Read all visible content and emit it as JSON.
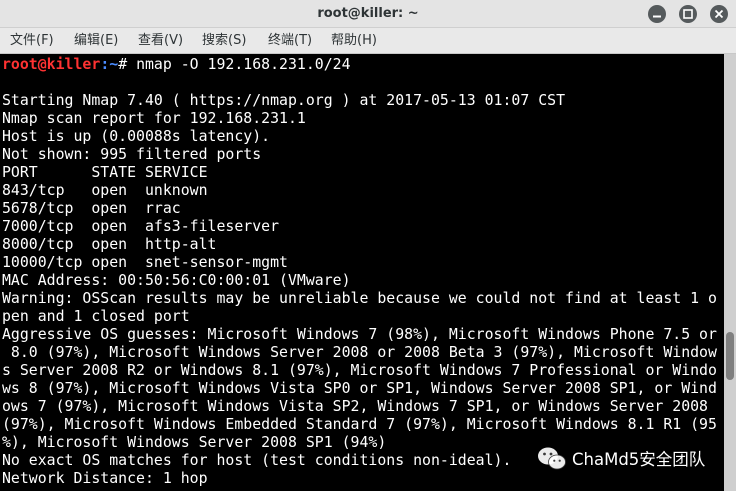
{
  "window": {
    "title": "root@killer: ~",
    "buttons": [
      "minimize-icon",
      "maximize-icon",
      "close-icon"
    ]
  },
  "menu": {
    "items": [
      {
        "label": "文件(F)"
      },
      {
        "label": "编辑(E)"
      },
      {
        "label": "查看(V)"
      },
      {
        "label": "搜索(S)"
      },
      {
        "label": "终端(T)"
      },
      {
        "label": "帮助(H)"
      }
    ]
  },
  "terminal": {
    "prompt": {
      "user": "root@killer",
      "path": ":~",
      "symbol": "# ",
      "command": "nmap -O 192.168.231.0/24"
    },
    "lines": [
      "",
      "Starting Nmap 7.40 ( https://nmap.org ) at 2017-05-13 01:07 CST",
      "Nmap scan report for 192.168.231.1",
      "Host is up (0.00088s latency).",
      "Not shown: 995 filtered ports",
      "PORT      STATE SERVICE",
      "843/tcp   open  unknown",
      "5678/tcp  open  rrac",
      "7000/tcp  open  afs3-fileserver",
      "8000/tcp  open  http-alt",
      "10000/tcp open  snet-sensor-mgmt",
      "MAC Address: 00:50:56:C0:00:01 (VMware)",
      "Warning: OSScan results may be unreliable because we could not find at least 1 o",
      "pen and 1 closed port",
      "Aggressive OS guesses: Microsoft Windows 7 (98%), Microsoft Windows Phone 7.5 or",
      " 8.0 (97%), Microsoft Windows Server 2008 or 2008 Beta 3 (97%), Microsoft Window",
      "s Server 2008 R2 or Windows 8.1 (97%), Microsoft Windows 7 Professional or Windo",
      "ws 8 (97%), Microsoft Windows Vista SP0 or SP1, Windows Server 2008 SP1, or Wind",
      "ows 7 (97%), Microsoft Windows Vista SP2, Windows 7 SP1, or Windows Server 2008",
      "(97%), Microsoft Windows Embedded Standard 7 (97%), Microsoft Windows 8.1 R1 (95",
      "%), Microsoft Windows Server 2008 SP1 (94%)",
      "No exact OS matches for host (test conditions non-ideal).",
      "Network Distance: 1 hop"
    ]
  },
  "watermark": {
    "text": "ChaMd5安全团队",
    "icon": "wechat-icon"
  },
  "colors": {
    "terminal_bg": "#000000",
    "terminal_fg": "#ffffff",
    "prompt_user": "#ff3232",
    "prompt_path": "#4a8cff"
  }
}
